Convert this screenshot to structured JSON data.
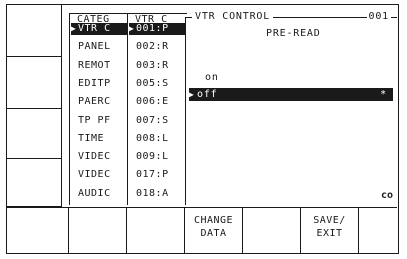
{
  "category_panel": {
    "title": "CATEG",
    "items": [
      "VTR C",
      "PANEL",
      "REMOT",
      "EDITP",
      "PAERC",
      "TP PF",
      "TIME",
      "VIDEC",
      "VIDEC",
      "AUDIC"
    ],
    "selected_index": 0,
    "selected_marker": "▶"
  },
  "item_panel": {
    "title": "VTR C",
    "items": [
      "001:P",
      "002:R",
      "003:R",
      "005:S",
      "006:E",
      "007:S",
      "008:L",
      "009:L",
      "017:P",
      "018:A"
    ],
    "selected_index": 0,
    "selected_marker": "▶"
  },
  "vtr_control": {
    "title": "VTR CONTROL",
    "number": "001",
    "subtitle": "PRE-READ",
    "options": [
      {
        "label": "on",
        "selected": false,
        "mark": ""
      },
      {
        "label": "off",
        "selected": true,
        "mark": "*"
      }
    ],
    "selected_marker": "▶",
    "scroll_glyph": "co"
  },
  "soft_keys": {
    "change_data": [
      "CHANGE",
      "DATA"
    ],
    "save_exit": [
      "SAVE/",
      "EXIT"
    ]
  },
  "colors": {
    "foreground": "#1a1a1a",
    "background": "#ffffff"
  }
}
